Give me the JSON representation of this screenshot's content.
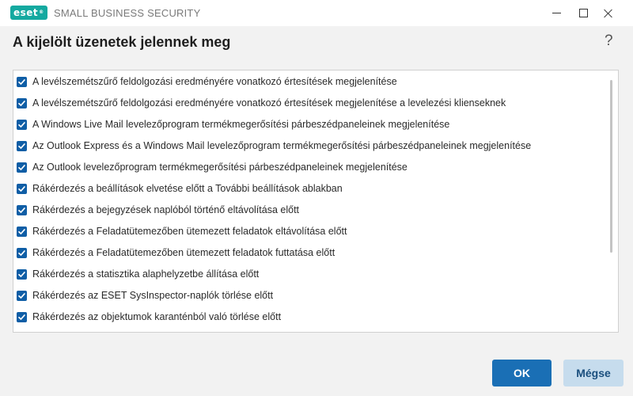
{
  "titlebar": {
    "logo_text": "eset",
    "product_name": "SMALL BUSINESS SECURITY",
    "minimize_icon": "minimize-icon",
    "maximize_icon": "maximize-icon",
    "close_icon": "close-icon"
  },
  "dialog": {
    "title": "A kijelölt üzenetek jelennek meg",
    "help_label": "?"
  },
  "messages": [
    {
      "label": "A levélszemétszűrő feldolgozási eredményére vonatkozó értesítések megjelenítése",
      "checked": true
    },
    {
      "label": "A levélszemétszűrő feldolgozási eredményére vonatkozó értesítések megjelenítése a levelezési klienseknek",
      "checked": true
    },
    {
      "label": "A Windows Live Mail levelezőprogram termékmegerősítési párbeszédpaneleinek megjelenítése",
      "checked": true
    },
    {
      "label": "Az Outlook Express és a Windows Mail levelezőprogram termékmegerősítési párbeszédpaneleinek megjelenítése",
      "checked": true
    },
    {
      "label": "Az Outlook levelezőprogram termékmegerősítési párbeszédpaneleinek megjelenítése",
      "checked": true
    },
    {
      "label": "Rákérdezés a beállítások elvetése előtt a További beállítások ablakban",
      "checked": true
    },
    {
      "label": "Rákérdezés a bejegyzések naplóból történő eltávolítása előtt",
      "checked": true
    },
    {
      "label": "Rákérdezés a Feladatütemezőben ütemezett feladatok eltávolítása előtt",
      "checked": true
    },
    {
      "label": "Rákérdezés a Feladatütemezőben ütemezett feladatok futtatása előtt",
      "checked": true
    },
    {
      "label": "Rákérdezés a statisztika alaphelyzetbe állítása előtt",
      "checked": true
    },
    {
      "label": "Rákérdezés az ESET SysInspector-naplók törlése előtt",
      "checked": true
    },
    {
      "label": "Rákérdezés az objektumok karanténból való törlése előtt",
      "checked": true
    },
    {
      "label": "",
      "checked": true
    }
  ],
  "buttons": {
    "ok_label": "OK",
    "cancel_label": "Mégse"
  },
  "colors": {
    "brand": "#14a9a0",
    "accent": "#1a6fb5",
    "checkbox": "#0f5ea6"
  }
}
